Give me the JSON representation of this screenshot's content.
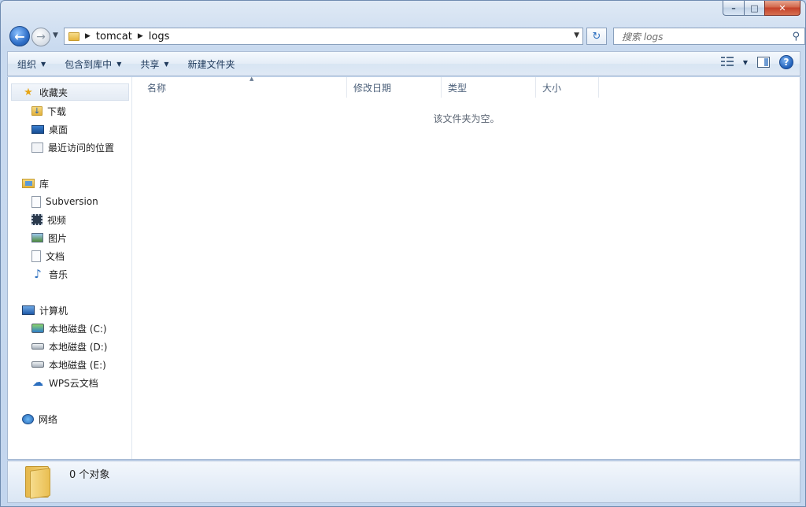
{
  "window": {
    "caption": {
      "minimize": "–",
      "maximize": "□",
      "close": "✕"
    }
  },
  "address": {
    "back": "back-arrow-icon",
    "forward": "forward-arrow-icon",
    "breadcrumbs": [
      "tomcat",
      "logs"
    ],
    "search_placeholder": "搜索 logs"
  },
  "toolbar": {
    "organize": "组织",
    "include_in_library": "包含到库中",
    "share": "共享",
    "new_folder": "新建文件夹"
  },
  "sidebar": {
    "favorites": {
      "label": "收藏夹",
      "items": [
        "下载",
        "桌面",
        "最近访问的位置"
      ]
    },
    "libraries": {
      "label": "库",
      "items": [
        "Subversion",
        "视频",
        "图片",
        "文档",
        "音乐"
      ]
    },
    "computer": {
      "label": "计算机",
      "items": [
        "本地磁盘 (C:)",
        "本地磁盘 (D:)",
        "本地磁盘 (E:)",
        "WPS云文档"
      ]
    },
    "network": {
      "label": "网络"
    }
  },
  "file_list": {
    "columns": [
      "名称",
      "修改日期",
      "类型",
      "大小"
    ],
    "empty_message": "该文件夹为空。"
  },
  "details": {
    "count": "0 个对象"
  },
  "colors": {
    "accent": "#2c6fbf",
    "window_frame": "#c3d6ee",
    "close": "#c4412a"
  }
}
